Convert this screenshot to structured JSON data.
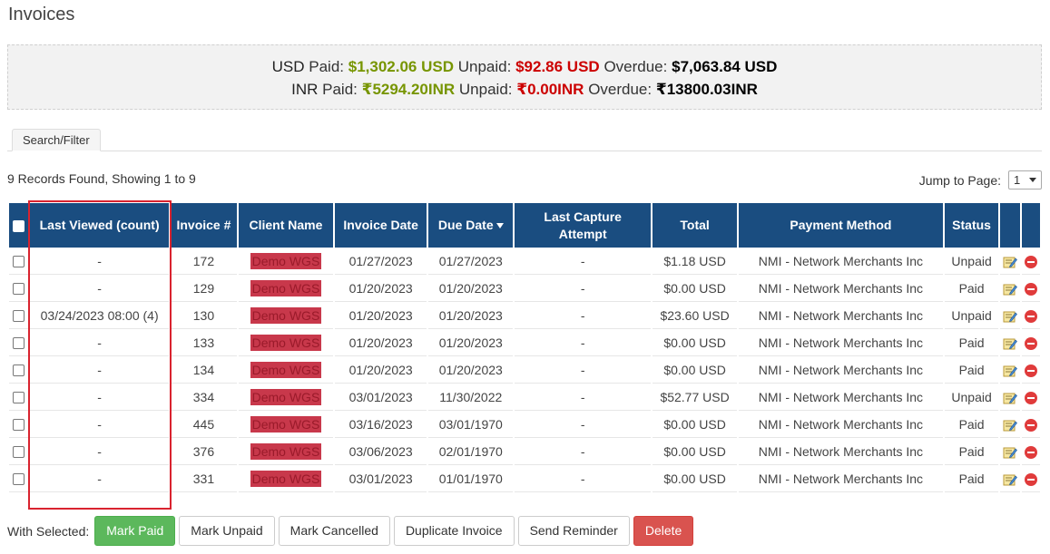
{
  "page": {
    "title": "Invoices"
  },
  "summary": {
    "usd": {
      "currency": "USD",
      "paid_label": "Paid:",
      "paid": "$1,302.06 USD",
      "unpaid_label": "Unpaid:",
      "unpaid": "$92.86 USD",
      "overdue_label": "Overdue:",
      "overdue": "$7,063.84 USD"
    },
    "inr": {
      "currency": "INR",
      "paid_label": "Paid:",
      "paid": "₹5294.20INR",
      "unpaid_label": "Unpaid:",
      "unpaid": "₹0.00INR",
      "overdue_label": "Overdue:",
      "overdue": "₹13800.03INR"
    }
  },
  "tabs": {
    "search_filter": "Search/Filter"
  },
  "records": {
    "text": "9 Records Found, Showing 1 to 9"
  },
  "jump": {
    "label": "Jump to Page:",
    "value": "1"
  },
  "table": {
    "headers": {
      "last_viewed": "Last Viewed (count)",
      "invoice": "Invoice #",
      "client": "Client Name",
      "invoice_date": "Invoice Date",
      "due_date": "Due Date",
      "last_capture_line1": "Last Capture",
      "last_capture_line2": "Attempt",
      "total": "Total",
      "payment_method": "Payment Method",
      "status": "Status"
    },
    "rows": [
      {
        "last_viewed": "-",
        "invoice": "172",
        "client": "Demo WGS",
        "invoice_date": "01/27/2023",
        "due_date": "01/27/2023",
        "last_capture": "-",
        "total": "$1.18 USD",
        "payment_method": "NMI - Network Merchants Inc",
        "status": "Unpaid"
      },
      {
        "last_viewed": "-",
        "invoice": "129",
        "client": "Demo WGS",
        "invoice_date": "01/20/2023",
        "due_date": "01/20/2023",
        "last_capture": "-",
        "total": "$0.00 USD",
        "payment_method": "NMI - Network Merchants Inc",
        "status": "Paid"
      },
      {
        "last_viewed": "03/24/2023 08:00 (4)",
        "invoice": "130",
        "client": "Demo WGS",
        "invoice_date": "01/20/2023",
        "due_date": "01/20/2023",
        "last_capture": "-",
        "total": "$23.60 USD",
        "payment_method": "NMI - Network Merchants Inc",
        "status": "Unpaid"
      },
      {
        "last_viewed": "-",
        "invoice": "133",
        "client": "Demo WGS",
        "invoice_date": "01/20/2023",
        "due_date": "01/20/2023",
        "last_capture": "-",
        "total": "$0.00 USD",
        "payment_method": "NMI - Network Merchants Inc",
        "status": "Paid"
      },
      {
        "last_viewed": "-",
        "invoice": "134",
        "client": "Demo WGS",
        "invoice_date": "01/20/2023",
        "due_date": "01/20/2023",
        "last_capture": "-",
        "total": "$0.00 USD",
        "payment_method": "NMI - Network Merchants Inc",
        "status": "Paid"
      },
      {
        "last_viewed": "-",
        "invoice": "334",
        "client": "Demo WGS",
        "invoice_date": "03/01/2023",
        "due_date": "11/30/2022",
        "last_capture": "-",
        "total": "$52.77 USD",
        "payment_method": "NMI - Network Merchants Inc",
        "status": "Unpaid"
      },
      {
        "last_viewed": "-",
        "invoice": "445",
        "client": "Demo WGS",
        "invoice_date": "03/16/2023",
        "due_date": "03/01/1970",
        "last_capture": "-",
        "total": "$0.00 USD",
        "payment_method": "NMI - Network Merchants Inc",
        "status": "Paid"
      },
      {
        "last_viewed": "-",
        "invoice": "376",
        "client": "Demo WGS",
        "invoice_date": "03/06/2023",
        "due_date": "02/01/1970",
        "last_capture": "-",
        "total": "$0.00 USD",
        "payment_method": "NMI - Network Merchants Inc",
        "status": "Paid"
      },
      {
        "last_viewed": "-",
        "invoice": "331",
        "client": "Demo WGS",
        "invoice_date": "03/01/2023",
        "due_date": "01/01/1970",
        "last_capture": "-",
        "total": "$0.00 USD",
        "payment_method": "NMI - Network Merchants Inc",
        "status": "Paid"
      }
    ]
  },
  "actions": {
    "with_selected": "With Selected:",
    "mark_paid": "Mark Paid",
    "mark_unpaid": "Mark Unpaid",
    "mark_cancelled": "Mark Cancelled",
    "duplicate": "Duplicate Invoice",
    "send_reminder": "Send Reminder",
    "delete": "Delete"
  },
  "colors": {
    "header_bg": "#1a4d80",
    "paid": "#7f9a1c",
    "unpaid": "#cc0000",
    "highlight": "#d9232f"
  }
}
